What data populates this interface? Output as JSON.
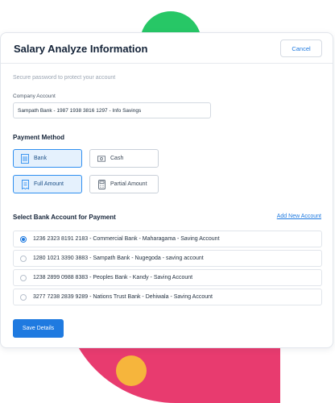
{
  "dialog": {
    "title": "Salary Analyze Information",
    "cancel_label": "Cancel",
    "hint": "Secure password to protect your account",
    "company_account": {
      "label": "Company Account",
      "value": "Sampath Bank - 1987 1938 3816 1297 - Info Savings"
    }
  },
  "payment_method": {
    "title": "Payment Method",
    "options": [
      {
        "label": "Bank",
        "icon": "bank-icon",
        "selected": true
      },
      {
        "label": "Cash",
        "icon": "cash-icon",
        "selected": false
      },
      {
        "label": "Full Amount",
        "icon": "receipt-icon",
        "selected": true
      },
      {
        "label": "Partial Amount",
        "icon": "calculator-icon",
        "selected": false
      }
    ]
  },
  "bank_accounts": {
    "title": "Select Bank Account for Payment",
    "add_link": "Add New Account",
    "items": [
      {
        "label": "1236 2323 8191 2183 - Commercial Bank - Maharagama - Saving Account",
        "selected": true
      },
      {
        "label": "1280 1021 3390 3883 - Sampath Bank - Nugegoda - saving account",
        "selected": false
      },
      {
        "label": "1238 2899 0988 8383 - Peoples Bank - Kandy - Saving Account",
        "selected": false
      },
      {
        "label": "3277 7238 2839 9289 - Nations Trust Bank - Dehiwala - Saving Account",
        "selected": false
      }
    ]
  },
  "save_label": "Save Details",
  "colors": {
    "accent": "#1f7ae0",
    "selected_bg": "#e5f1fd",
    "green_blob": "#27c766",
    "pink_blob": "#e83b6f",
    "orange_blob": "#f6b53c"
  }
}
